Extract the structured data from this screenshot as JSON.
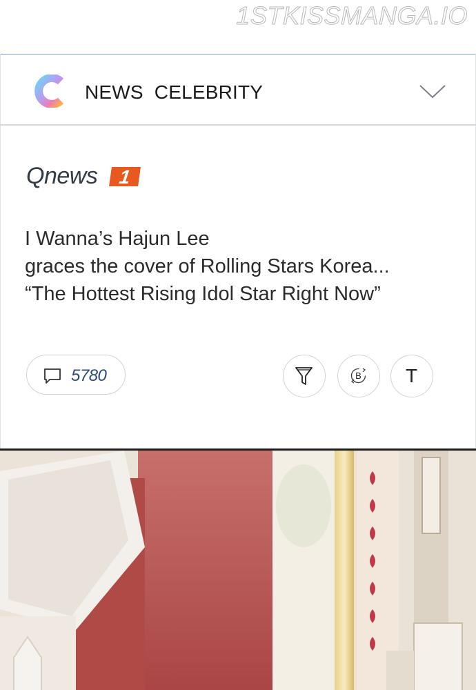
{
  "watermark": "1STKISSMANGA.IO",
  "header": {
    "title": "NEWS CELEBRITY"
  },
  "article": {
    "publisher": "Qnews",
    "publisher_badge": "1",
    "headline_lines": [
      "I Wanna’s Hajun Lee",
      "graces the cover of Rolling Stars Korea...",
      "“The Hottest Rising Idol Star Right Now”"
    ]
  },
  "actions": {
    "comment_count": "5780",
    "t_label": "T",
    "b_label": "B"
  },
  "colors": {
    "badge": "#e8591f",
    "comment_count": "#2b4a7a",
    "top_rule": "#7fa3c4"
  },
  "icons": [
    "app-logo-c",
    "chevron-down-icon",
    "comment-icon",
    "filter-icon",
    "b-rotate-icon"
  ]
}
